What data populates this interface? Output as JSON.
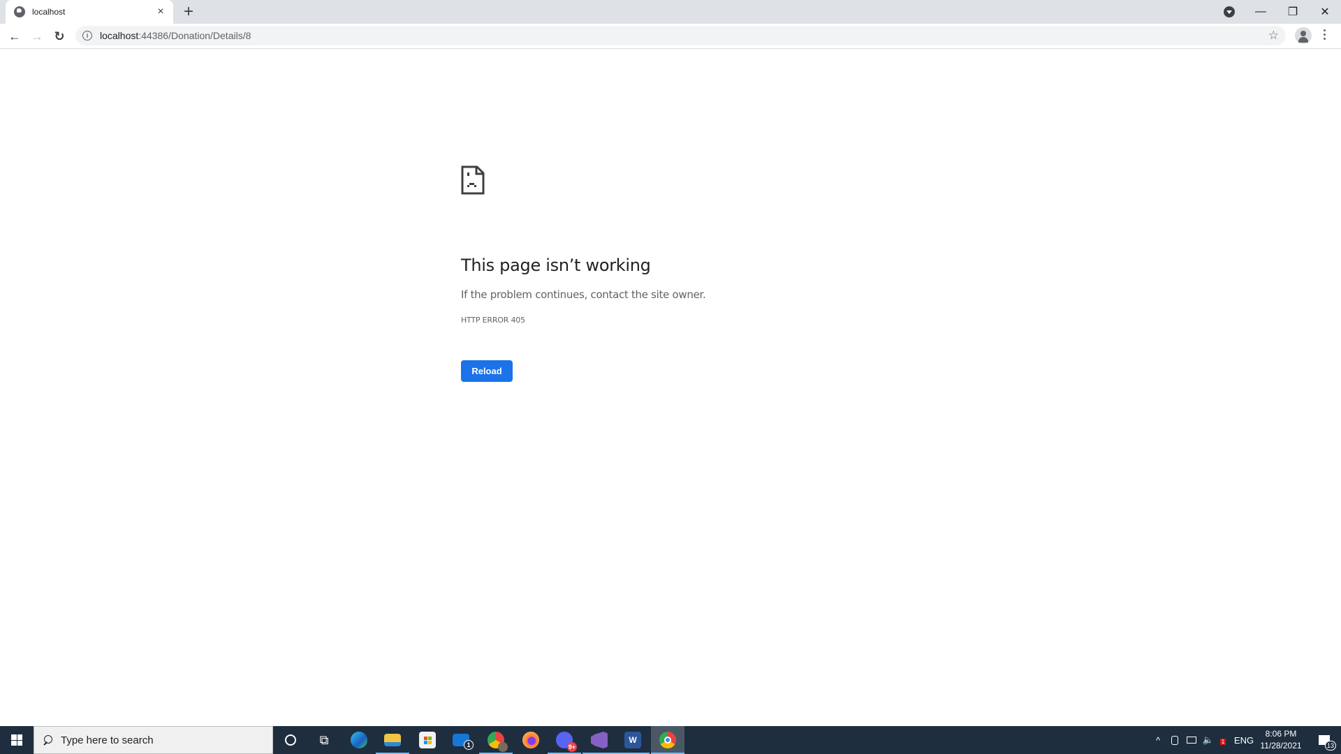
{
  "browser": {
    "tab": {
      "title": "localhost",
      "close_label": "×"
    },
    "new_tab_label": "+",
    "window_controls": {
      "minimize": "—",
      "restore": "❐",
      "close": "✕"
    },
    "nav": {
      "back": "←",
      "forward": "→",
      "reload": "↻"
    },
    "address": {
      "host": "localhost",
      "path": ":44386/Donation/Details/8",
      "info_glyph": "i"
    },
    "bookmark_star": "☆"
  },
  "error_page": {
    "icon": "sad-page-icon",
    "heading": "This page isn’t working",
    "message": "If the problem continues, contact the site owner.",
    "error_code": "HTTP ERROR 405",
    "reload_button": "Reload",
    "accent_color": "#1a73e8"
  },
  "taskbar": {
    "search_placeholder": "Type here to search",
    "apps": [
      {
        "name": "cortana",
        "glyph": "○"
      },
      {
        "name": "task-view",
        "glyph": "⧉"
      },
      {
        "name": "edge",
        "color": "#1b8ad3"
      },
      {
        "name": "file-explorer",
        "color": "#f3c441"
      },
      {
        "name": "microsoft-store",
        "color": "#f2f2f2"
      },
      {
        "name": "mail",
        "color": "#1677d6",
        "badge": "1"
      },
      {
        "name": "chrome-profile",
        "color": "#e8453c"
      },
      {
        "name": "firefox",
        "color": "#ff7139"
      },
      {
        "name": "discord",
        "color": "#5865f2",
        "badge": "9+"
      },
      {
        "name": "visual-studio",
        "color": "#8661c5"
      },
      {
        "name": "word",
        "color": "#2b579a",
        "glyph": "W"
      },
      {
        "name": "chrome",
        "color": "#4285f4"
      }
    ],
    "tray": {
      "chevron": "^",
      "language": "ENG",
      "time": "8:06 PM",
      "date": "11/28/2021",
      "notifications_count": "13",
      "app_badge": "1"
    }
  }
}
